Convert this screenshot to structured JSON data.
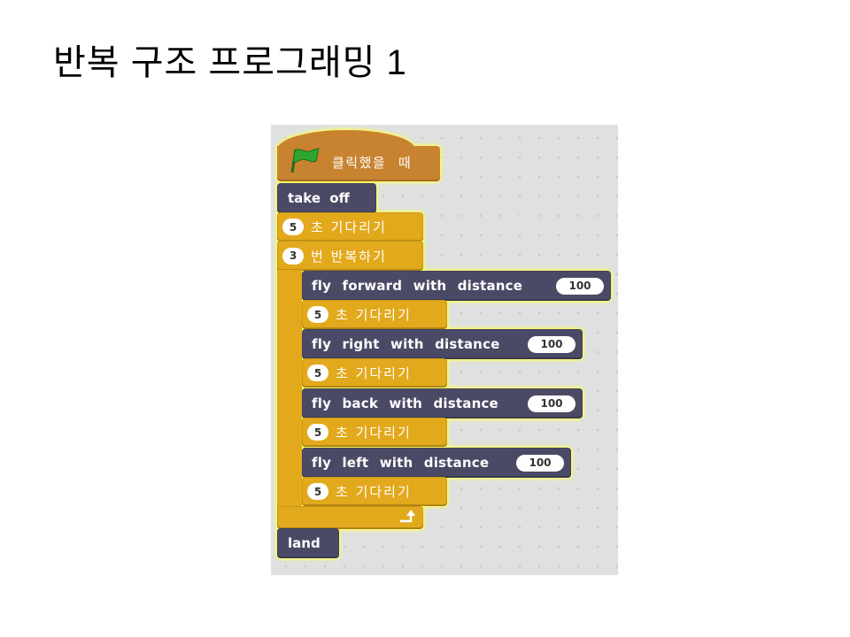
{
  "slide": {
    "title": "반복 구조 프로그래밍 1"
  },
  "colors": {
    "events": "#c88330",
    "custom": "#4b4a66",
    "control": "#e2a91c",
    "workspace": "#dfe1e1",
    "flag": "#2ea52e",
    "glow": "#ffff55"
  },
  "script": {
    "hat": {
      "icon": "green-flag-icon",
      "label": "클릭했을 때"
    },
    "take_off": {
      "label": "take off"
    },
    "wait": {
      "value": "5",
      "label": "초 기다리기"
    },
    "repeat": {
      "value": "3",
      "label": "번 반복하기",
      "end_icon": "loop-arrow-icon",
      "body": [
        {
          "label": "fly forward with distance",
          "value": "100"
        },
        {
          "value": "5",
          "label": "초 기다리기"
        },
        {
          "label": "fly right with distance",
          "value": "100"
        },
        {
          "value": "5",
          "label": "초 기다리기"
        },
        {
          "label": "fly back with distance",
          "value": "100"
        },
        {
          "value": "5",
          "label": "초 기다리기"
        },
        {
          "label": "fly left with distance",
          "value": "100"
        },
        {
          "value": "5",
          "label": "초 기다리기"
        }
      ]
    },
    "land": {
      "label": "land"
    }
  }
}
